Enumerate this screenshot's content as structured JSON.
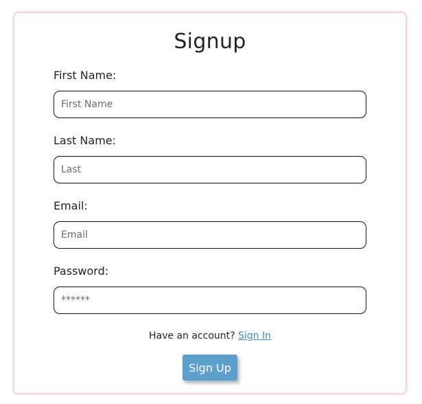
{
  "form": {
    "title": "Signup",
    "fields": [
      {
        "label": "First Name:",
        "placeholder": "First Name",
        "value": ""
      },
      {
        "label": "Last Name:",
        "placeholder": "Last",
        "value": ""
      },
      {
        "label": "Email:",
        "placeholder": "Email",
        "value": ""
      },
      {
        "label": "Password:",
        "placeholder": "******",
        "value": ""
      }
    ],
    "account_prompt": "Have an account?",
    "sign_in_link": "Sign In",
    "submit_label": "Sign Up"
  },
  "colors": {
    "card_border": "#f8d3d3",
    "button_bg": "#5d9fcd",
    "link": "#3d8ec9"
  }
}
